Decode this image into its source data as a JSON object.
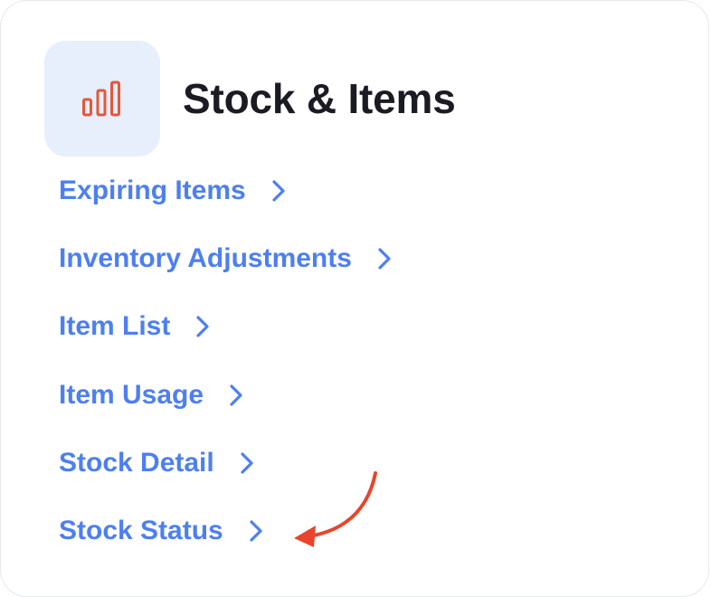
{
  "header": {
    "icon": "bar-chart-icon",
    "title": "Stock & Items"
  },
  "links": [
    {
      "label": "Expiring Items"
    },
    {
      "label": "Inventory Adjustments"
    },
    {
      "label": "Item List"
    },
    {
      "label": "Item Usage"
    },
    {
      "label": "Stock Detail"
    },
    {
      "label": "Stock Status"
    }
  ],
  "annotation": {
    "icon": "curved-arrow-icon",
    "points_to": "Stock Status"
  },
  "colors": {
    "link": "#4d7ff0",
    "title": "#1a1b23",
    "icon_bg": "#e7effc",
    "icon_stroke": "#e4573a",
    "arrow": "#e8452c"
  }
}
